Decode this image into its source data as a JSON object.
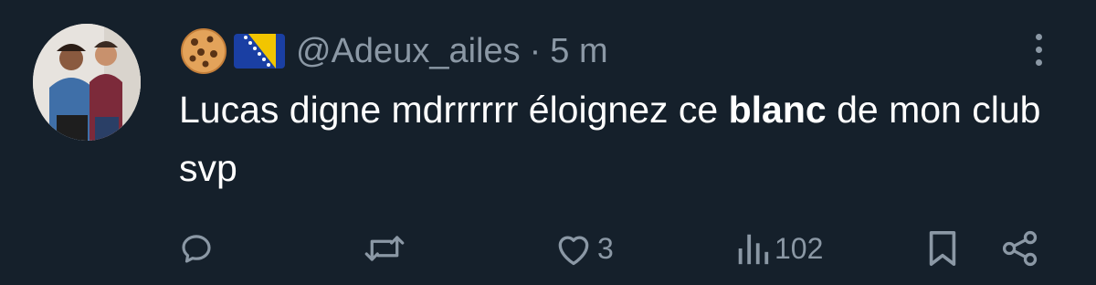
{
  "tweet": {
    "handle": "@Adeux_ailes",
    "separator": "·",
    "time": "5 m",
    "text_parts": [
      "Lucas digne mdrrrrrr éloignez ce ",
      "blanc",
      " de mon club svp"
    ],
    "emoji": [
      "cookie-emoji",
      "bosnia-flag-emoji"
    ]
  },
  "actions": {
    "reply_count": "",
    "retweet_count": "",
    "like_count": "3",
    "views_count": "102"
  },
  "icons": {
    "reply": "reply-icon",
    "retweet": "retweet-icon",
    "like": "heart-icon",
    "views": "views-icon",
    "bookmark": "bookmark-icon",
    "share": "share-icon",
    "more": "more-icon"
  },
  "colors": {
    "background": "#15202b",
    "text": "#ffffff",
    "muted": "#8b98a5"
  }
}
